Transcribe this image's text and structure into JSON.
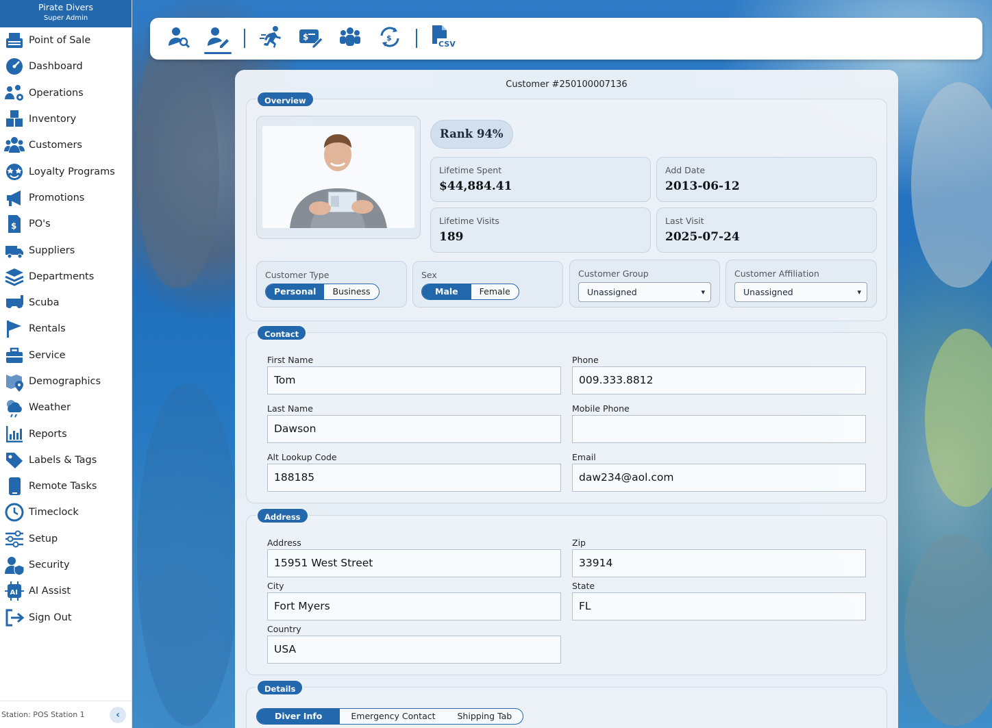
{
  "app": {
    "name": "Pirate Divers",
    "role": "Super Admin"
  },
  "sidebar": {
    "items": [
      {
        "label": "Point of Sale"
      },
      {
        "label": "Dashboard"
      },
      {
        "label": "Operations"
      },
      {
        "label": "Inventory"
      },
      {
        "label": "Customers"
      },
      {
        "label": "Loyalty Programs"
      },
      {
        "label": "Promotions"
      },
      {
        "label": "PO's"
      },
      {
        "label": "Suppliers"
      },
      {
        "label": "Departments"
      },
      {
        "label": "Scuba"
      },
      {
        "label": "Rentals"
      },
      {
        "label": "Service"
      },
      {
        "label": "Demographics"
      },
      {
        "label": "Weather"
      },
      {
        "label": "Reports"
      },
      {
        "label": "Labels & Tags"
      },
      {
        "label": "Remote Tasks"
      },
      {
        "label": "Timeclock"
      },
      {
        "label": "Setup"
      },
      {
        "label": "Security"
      },
      {
        "label": "AI Assist"
      },
      {
        "label": "Sign Out"
      }
    ],
    "station": "Station: POS Station 1"
  },
  "toolbar": {
    "icons": [
      "customer-search-icon",
      "customer-edit-icon",
      "activity-icon",
      "payment-edit-icon",
      "group-icon",
      "refresh-payment-icon",
      "csv-export-icon"
    ],
    "csv_label": "CSV"
  },
  "customer": {
    "title": "Customer #250100007136",
    "overview": {
      "section_label": "Overview",
      "rank": "Rank 94%",
      "lifetime_spent_label": "Lifetime Spent",
      "lifetime_spent": "$44,884.41",
      "add_date_label": "Add Date",
      "add_date": "2013-06-12",
      "lifetime_visits_label": "Lifetime Visits",
      "lifetime_visits": "189",
      "last_visit_label": "Last Visit",
      "last_visit": "2025-07-24",
      "customer_type_label": "Customer Type",
      "customer_type_options": [
        "Personal",
        "Business"
      ],
      "sex_label": "Sex",
      "sex_options": [
        "Male",
        "Female"
      ],
      "group_label": "Customer Group",
      "group_value": "Unassigned",
      "affiliation_label": "Customer Affiliation",
      "affiliation_value": "Unassigned"
    },
    "contact": {
      "section_label": "Contact",
      "first_name_label": "First Name",
      "first_name": "Tom",
      "phone_label": "Phone",
      "phone": "009.333.8812",
      "last_name_label": "Last Name",
      "last_name": "Dawson",
      "mobile_label": "Mobile Phone",
      "mobile": "",
      "alt_lookup_label": "Alt Lookup Code",
      "alt_lookup": "188185",
      "email_label": "Email",
      "email": "daw234@aol.com"
    },
    "address": {
      "section_label": "Address",
      "address_label": "Address",
      "address": "15951 West Street",
      "zip_label": "Zip",
      "zip": "33914",
      "city_label": "City",
      "city": "Fort Myers",
      "state_label": "State",
      "state": "FL",
      "country_label": "Country",
      "country": "USA"
    },
    "details": {
      "section_label": "Details",
      "tabs": [
        "Diver Info",
        "Emergency Contact",
        "Shipping Tab"
      ]
    }
  },
  "colors": {
    "accent": "#2367ac",
    "panel": "#eef3f8"
  }
}
